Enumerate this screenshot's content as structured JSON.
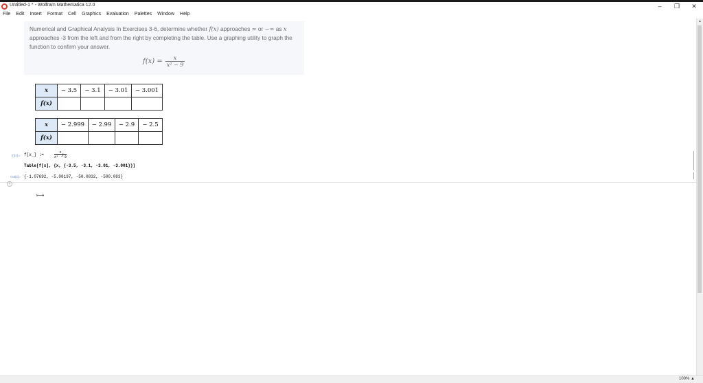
{
  "window": {
    "title": "Untitled-1 * - Wolfram Mathematica 12.0",
    "minimize": "–",
    "restore": "❐",
    "close": "✕"
  },
  "menu": [
    "File",
    "Edit",
    "Insert",
    "Format",
    "Cell",
    "Graphics",
    "Evaluation",
    "Palettes",
    "Window",
    "Help"
  ],
  "problem": {
    "line1_a": "Numerical and Graphical Analysis In Exercises 3-6, determine whether ",
    "fx": "f(x)",
    "line1_b": " approaches ",
    "inf": "∞",
    "or": " or ",
    "neginf": "−∞",
    "as": " as ",
    "x": "x",
    "line2": " approaches -3 from the left and from the right by completing the table. Use a graphing utility to graph the function to confirm your answer.",
    "formula_lhs": "f(x) =",
    "formula_num": "x",
    "formula_den": "x² − 9"
  },
  "table1": {
    "row_x_label": "x",
    "row_f_label": "f(x)",
    "x_values": [
      "− 3.5",
      "− 3.1",
      "− 3.01",
      "− 3.001"
    ],
    "f_values": [
      "",
      "",
      "",
      ""
    ]
  },
  "table2": {
    "row_x_label": "x",
    "row_f_label": "f(x)",
    "x_values": [
      "− 2.999",
      "− 2.99",
      "− 2.9",
      "− 2.5"
    ],
    "f_values": [
      "",
      "",
      "",
      ""
    ]
  },
  "notebook": {
    "in_label": "In[1]:=",
    "def_prefix": "f[x_] :=",
    "def_num": "x",
    "def_den": "x² - 9",
    "def_suffix": ";",
    "table_cmd": "Table[f[x], {x, {-3.5, -3.1, -3.01, -3.001}}]",
    "out_label": "Out[2]=",
    "output": "{-1.07692, -5.08197, -50.0832, -500.083}"
  },
  "status": {
    "zoom": "100%"
  },
  "colors": {
    "table_header_bg": "#dde9f7",
    "problem_bg": "#f5f7fa",
    "app_icon": "#d8392b"
  }
}
